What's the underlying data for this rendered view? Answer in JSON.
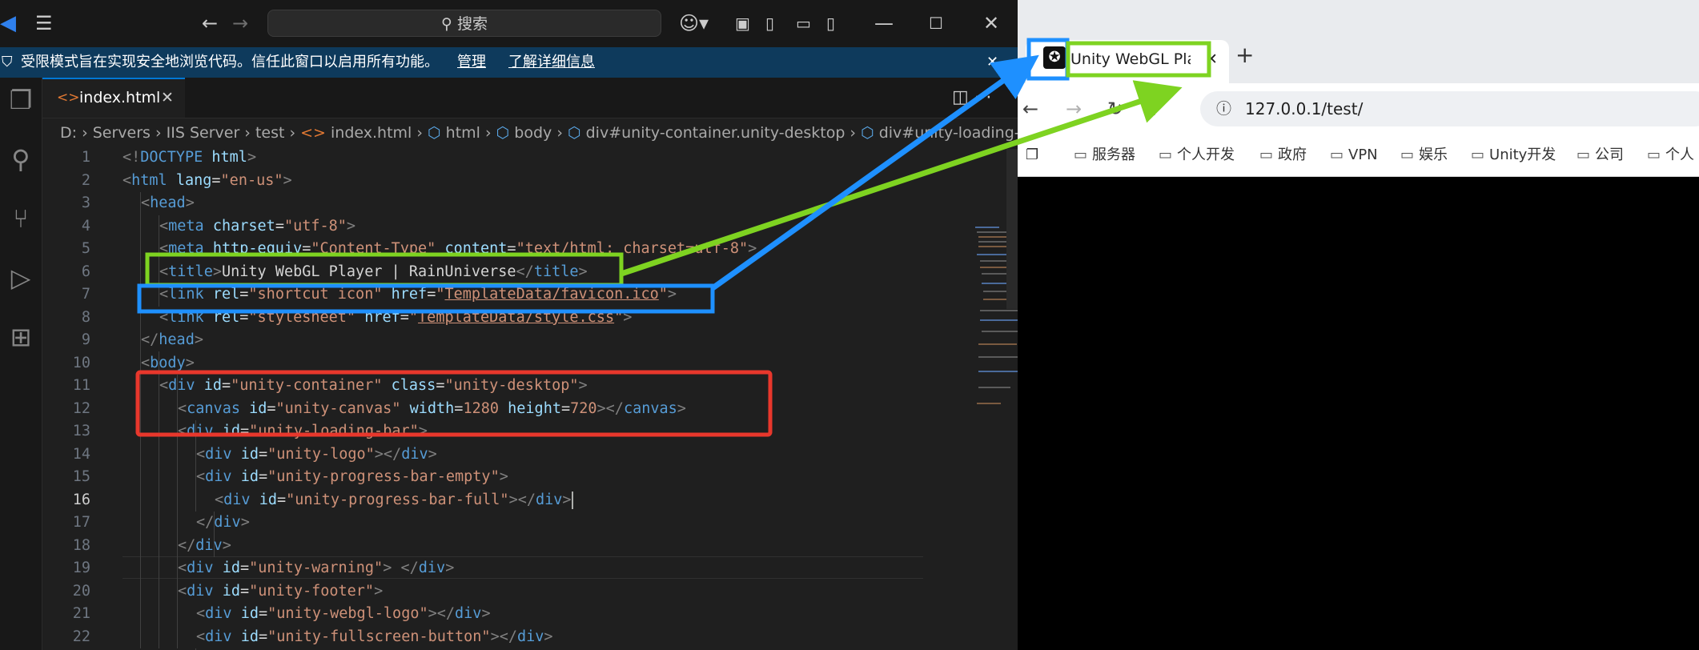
{
  "vscode": {
    "search_placeholder": "搜索",
    "restricted_mode": {
      "message": "受限模式旨在实现安全地浏览代码。信任此窗口以启用所有功能。",
      "manage": "管理",
      "learn_more": "了解详细信息"
    },
    "tab": {
      "label": "index.html",
      "close": "✕"
    },
    "breadcrumb": [
      "D:",
      "Servers",
      "IIS Server",
      "test",
      "index.html",
      "html",
      "body",
      "div#unity-container.unity-desktop",
      "div#unity-loading-bar"
    ],
    "lines": [
      {
        "n": "1"
      },
      {
        "n": "2"
      },
      {
        "n": "3"
      },
      {
        "n": "4"
      },
      {
        "n": "5"
      },
      {
        "n": "6"
      },
      {
        "n": "7"
      },
      {
        "n": "8"
      },
      {
        "n": "9"
      },
      {
        "n": "10"
      },
      {
        "n": "11"
      },
      {
        "n": "12"
      },
      {
        "n": "13"
      },
      {
        "n": "14"
      },
      {
        "n": "15"
      },
      {
        "n": "16"
      },
      {
        "n": "17"
      },
      {
        "n": "18"
      },
      {
        "n": "19"
      },
      {
        "n": "20"
      },
      {
        "n": "21"
      },
      {
        "n": "22"
      }
    ],
    "code": {
      "l1": {
        "a": "<!",
        "b": "DOCTYPE",
        "c": " ",
        "d": "html",
        "e": ">"
      },
      "l2": {
        "a": "<",
        "b": "html",
        "c": " lang",
        "d": "=",
        "e": "\"en-us\"",
        "f": ">"
      },
      "l3": {
        "a": "<",
        "b": "head",
        "c": ">"
      },
      "l4": {
        "a": "<",
        "b": "meta",
        "c": " charset",
        "d": "=",
        "e": "\"utf-8\"",
        "f": ">"
      },
      "l5": {
        "a": "<",
        "b": "meta",
        "c": " http-equiv",
        "d": "=",
        "e": "\"Content-Type\"",
        "f": " content",
        "g": "=",
        "h": "\"text/html; charset=utf-8\"",
        "i": ">"
      },
      "l6": {
        "a": "<",
        "b": "title",
        "c": ">",
        "d": "Unity WebGL Player | RainUniverse",
        "e": "</",
        "f": "title",
        "g": ">"
      },
      "l7": {
        "a": "<",
        "b": "link",
        "c": " rel",
        "d": "=",
        "e": "\"shortcut icon\"",
        "f": " href",
        "g": "=",
        "h": "\"",
        "i": "TemplateData/favicon.ico",
        "j": "\"",
        "k": ">"
      },
      "l8": {
        "a": "<",
        "b": "link",
        "c": " rel",
        "d": "=",
        "e": "\"stylesheet\"",
        "f": " href",
        "g": "=",
        "h": "\"",
        "i": "TemplateData/style.css",
        "j": "\"",
        "k": ">"
      },
      "l9": {
        "a": "</",
        "b": "head",
        "c": ">"
      },
      "l10": {
        "a": "<",
        "b": "body",
        "c": ">"
      },
      "l11": {
        "a": "<",
        "b": "div",
        "c": " id",
        "d": "=",
        "e": "\"unity-container\"",
        "f": " class",
        "g": "=",
        "h": "\"unity-desktop\"",
        "i": ">"
      },
      "l12": {
        "a": "<",
        "b": "canvas",
        "c": " id",
        "d": "=",
        "e": "\"unity-canvas\"",
        "f": " width",
        "g": "=",
        "h": "1280",
        "i": " height",
        "j": "=",
        "k": "720",
        "l": "></",
        "m": "canvas",
        "n": ">"
      },
      "l13": {
        "a": "<",
        "b": "div",
        "c": " id",
        "d": "=",
        "e": "\"unity-loading-bar\"",
        "f": ">"
      },
      "l14": {
        "a": "<",
        "b": "div",
        "c": " id",
        "d": "=",
        "e": "\"unity-logo\"",
        "f": "></",
        "g": "div",
        "h": ">"
      },
      "l15": {
        "a": "<",
        "b": "div",
        "c": " id",
        "d": "=",
        "e": "\"unity-progress-bar-empty\"",
        "f": ">"
      },
      "l16": {
        "a": "<",
        "b": "div",
        "c": " id",
        "d": "=",
        "e": "\"unity-progress-bar-full\"",
        "f": "></",
        "g": "div",
        "h": ">"
      },
      "l17": {
        "a": "</",
        "b": "div",
        "c": ">"
      },
      "l18": {
        "a": "</",
        "b": "div",
        "c": ">"
      },
      "l19": {
        "a": "<",
        "b": "div",
        "c": " id",
        "d": "=",
        "e": "\"unity-warning\"",
        "f": "> </",
        "g": "div",
        "h": ">"
      },
      "l20": {
        "a": "<",
        "b": "div",
        "c": " id",
        "d": "=",
        "e": "\"unity-footer\"",
        "f": ">"
      },
      "l21": {
        "a": "<",
        "b": "div",
        "c": " id",
        "d": "=",
        "e": "\"unity-webgl-logo\"",
        "f": "></",
        "g": "div",
        "h": ">"
      },
      "l22": {
        "a": "<",
        "b": "div",
        "c": " id",
        "d": "=",
        "e": "\"unity-fullscreen-button\"",
        "f": "></",
        "g": "div",
        "h": ">"
      }
    }
  },
  "browser": {
    "tab_title": "Unity WebGL Pla",
    "address": "127.0.0.1/test/",
    "bookmarks": [
      "服务器",
      "个人开发",
      "政府",
      "VPN",
      "娱乐",
      "Unity开发",
      "公司",
      "个人"
    ]
  },
  "colors": {
    "highlight_green": "#7ed321",
    "highlight_blue": "#1e90ff",
    "highlight_red": "#e8372c"
  }
}
